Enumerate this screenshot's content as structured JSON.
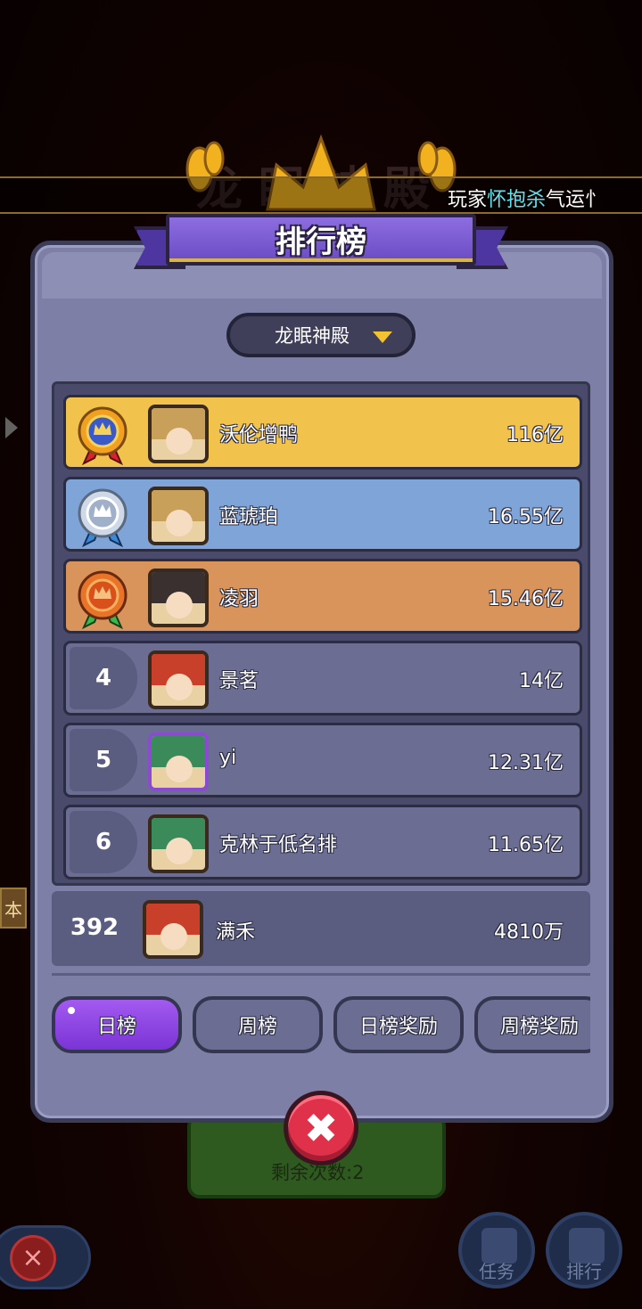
{
  "background": {
    "title_text": "龙眠神殿",
    "panel_remaining": "剩余次数:2",
    "side_tab_text": "本",
    "bottom_buttons": [
      {
        "label": "任务",
        "icon": "quill-icon"
      },
      {
        "label": "排行",
        "icon": "trophy-icon"
      }
    ]
  },
  "marquee": {
    "prefix": "玩家",
    "highlight": "怀抱杀",
    "suffix": "气运忄"
  },
  "header": {
    "title": "排行榜"
  },
  "selector": {
    "selected": "龙眠神殿"
  },
  "leaderboard": [
    {
      "rank": "1",
      "medal": "gold-medal-icon",
      "name": "沃伦增鸭",
      "score": "116亿",
      "tier": "gold"
    },
    {
      "rank": "2",
      "medal": "silver-medal-icon",
      "name": "蓝琥珀",
      "score": "16.55亿",
      "tier": "silver"
    },
    {
      "rank": "3",
      "medal": "bronze-medal-icon",
      "name": "凌羽",
      "score": "15.46亿",
      "tier": "bronze"
    },
    {
      "rank": "4",
      "name": "景茗",
      "score": "14亿",
      "tier": "normal"
    },
    {
      "rank": "5",
      "name": "yi",
      "score": "12.31亿",
      "tier": "normal"
    },
    {
      "rank": "6",
      "name": "克林于低名排",
      "score": "11.65亿",
      "tier": "normal"
    }
  ],
  "my_rank": {
    "rank": "392",
    "name": "满禾",
    "score": "4810万"
  },
  "tabs": [
    {
      "label": "日榜",
      "active": true
    },
    {
      "label": "周榜",
      "active": false
    },
    {
      "label": "日榜奖励",
      "active": false
    },
    {
      "label": "周榜奖励",
      "active": false
    }
  ],
  "colors": {
    "gold": "#f2c34c",
    "silver": "#7ea4d8",
    "bronze": "#d8945a",
    "row": "#6b6d93",
    "accent_purple": "#7b34d6",
    "close_red": "#e0314a"
  }
}
